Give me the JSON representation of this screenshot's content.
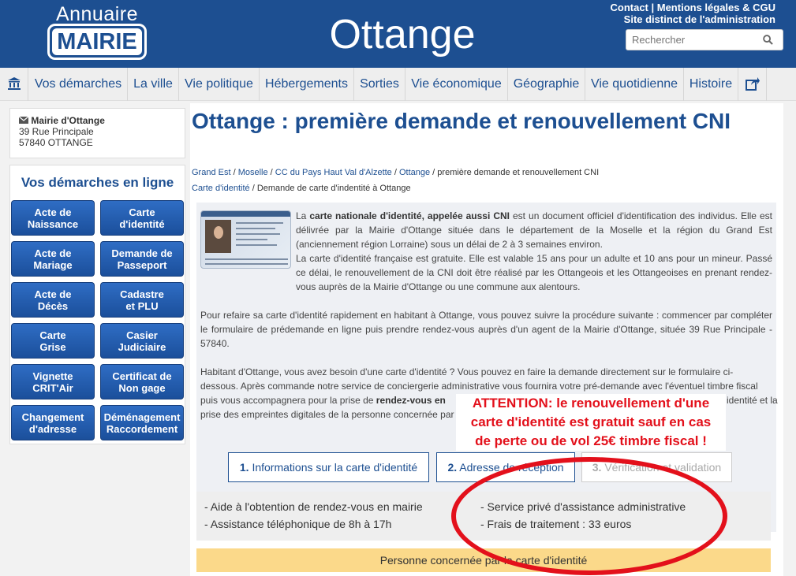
{
  "header": {
    "logo_top": "Annuaire",
    "logo_main": "MAIRIE",
    "site_title": "Ottange",
    "top_link_contact": "Contact",
    "top_link_sep": " | ",
    "top_link_legal": "Mentions légales & CGU",
    "top_link_distinct": "Site distinct de l'administration",
    "search_placeholder": "Rechercher"
  },
  "nav": {
    "items": [
      "Vos démarches",
      "La ville",
      "Vie politique",
      "Hébergements",
      "Sorties",
      "Vie économique",
      "Géographie",
      "Vie quotidienne",
      "Histoire"
    ]
  },
  "sidebar": {
    "mairie_name": "Mairie d'Ottange",
    "mairie_street": "39 Rue Principale",
    "mairie_city": "57840 OTTANGE",
    "section_title": "Vos démarches en ligne",
    "buttons": [
      [
        "Acte de",
        "Naissance"
      ],
      [
        "Carte",
        "d'identité"
      ],
      [
        "Acte de",
        "Mariage"
      ],
      [
        "Demande de",
        "Passeport"
      ],
      [
        "Acte de",
        "Décès"
      ],
      [
        "Cadastre",
        "et PLU"
      ],
      [
        "Carte",
        "Grise"
      ],
      [
        "Casier",
        "Judiciaire"
      ],
      [
        "Vignette",
        "CRIT'Air"
      ],
      [
        "Certificat de",
        "Non gage"
      ],
      [
        "Changement",
        "d'adresse"
      ],
      [
        "Déménagement",
        "Raccordement"
      ]
    ]
  },
  "main": {
    "title": "Ottange : première demande et renouvellement CNI",
    "breadcrumb1": [
      "Grand Est",
      "Moselle",
      "CC du Pays Haut Val d'Alzette",
      "Ottange"
    ],
    "breadcrumb1_current": "première demande et renouvellement CNI",
    "breadcrumb2_link": "Carte d'identité",
    "breadcrumb2_current": "Demande de carte d'indentité à Ottange",
    "sep": " / ",
    "p1_a": "La ",
    "p1_bold": "carte nationale d'identité, appelée aussi CNI",
    "p1_b": " est un document officiel d'identification des individus. Elle est délivrée par la Mairie d'Ottange située dans le département de la Moselle et la région du Grand Est (anciennement région Lorraine) sous un délai de 2 à 3 semaines environ.",
    "p2": "La carte d'identité française est gratuite. Elle est valable 15 ans pour un adulte et 10 ans pour un mineur. Passé ce délai, le renouvellement de la CNI doit être réalisé par les Ottangeois et les Ottangeoises en prenant rendez-vous auprès de la Mairie d'Ottange ou une commune aux alentours.",
    "p3": "Pour refaire sa carte d'identité rapidement en habitant à Ottange, vous pouvez suivre la procédure suivante : commencer par compléter le formulaire de prédemande en ligne puis prendre rendez-vous auprès d'un agent de la Mairie d'Ottange, située 39 Rue Principale - 57840.",
    "p4_line1": "Habitant d'Ottange, vous avez besoin d'une carte d'identité ? Vous pouvez en faire la demande directement sur le formulaire ci-",
    "p4_line2": "dessous. Après commande notre service de conciergerie administrative vous fournira votre pré-demande avec l'éventuel timbre fiscal",
    "p4_line3a": "puis vous accompagnera pour la prise de ",
    "p4_line3b": "rendez-vous en",
    "p4_line3c": "identité et la",
    "p4_line4": "prise des empreintes digitales de la personne concernée par",
    "steps": [
      {
        "num": "1.",
        "label": " Informations sur la carte d'identité"
      },
      {
        "num": "2.",
        "label": " Adresse de réception"
      },
      {
        "num": "3.",
        "label": " Vérification et validation"
      }
    ],
    "features_left": [
      "- Aide à l'obtention de rendez-vous en mairie",
      "- Assistance téléphonique de 8h à 17h"
    ],
    "features_right": [
      "- Service privé d'assistance administrative",
      "- Frais de traitement : 33 euros"
    ],
    "personne": "Personne concernée par la carte d'identité"
  },
  "annotation": {
    "lines": [
      "ATTENTION: le renouvellement d'une",
      "carte d'identité est gratuit sauf en cas",
      "de perte ou de vol 25€ timbre fiscal !"
    ],
    "color": "#e3101b"
  }
}
